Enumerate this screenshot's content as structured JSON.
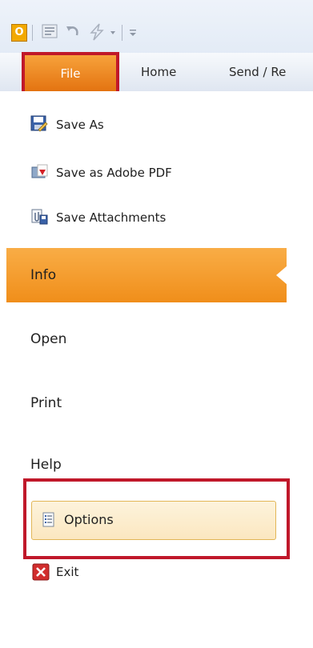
{
  "app": {
    "icon_letter": "O"
  },
  "quick_access": {
    "icons": [
      "app-outlook-icon",
      "send-receive-icon",
      "undo-icon",
      "quick-steps-icon",
      "customize-dropdown-icon"
    ]
  },
  "tabs": {
    "file_label": "File",
    "home_label": "Home",
    "send_receive_label": "Send / Re"
  },
  "backstage": {
    "commands": [
      {
        "label": "Save As",
        "icon": "save-as-icon"
      },
      {
        "label": "Save as Adobe PDF",
        "icon": "adobe-pdf-icon"
      },
      {
        "label": "Save Attachments",
        "icon": "attachments-icon"
      }
    ],
    "info_label": "Info",
    "open_label": "Open",
    "print_label": "Print",
    "help_label": "Help",
    "options_label": "Options",
    "exit_label": "Exit"
  },
  "colors": {
    "highlight_red": "#c0182a",
    "file_tab_orange": "#ef8a1e",
    "info_band_orange": "#f5a033",
    "hover_fill": "#fbe7c0"
  }
}
